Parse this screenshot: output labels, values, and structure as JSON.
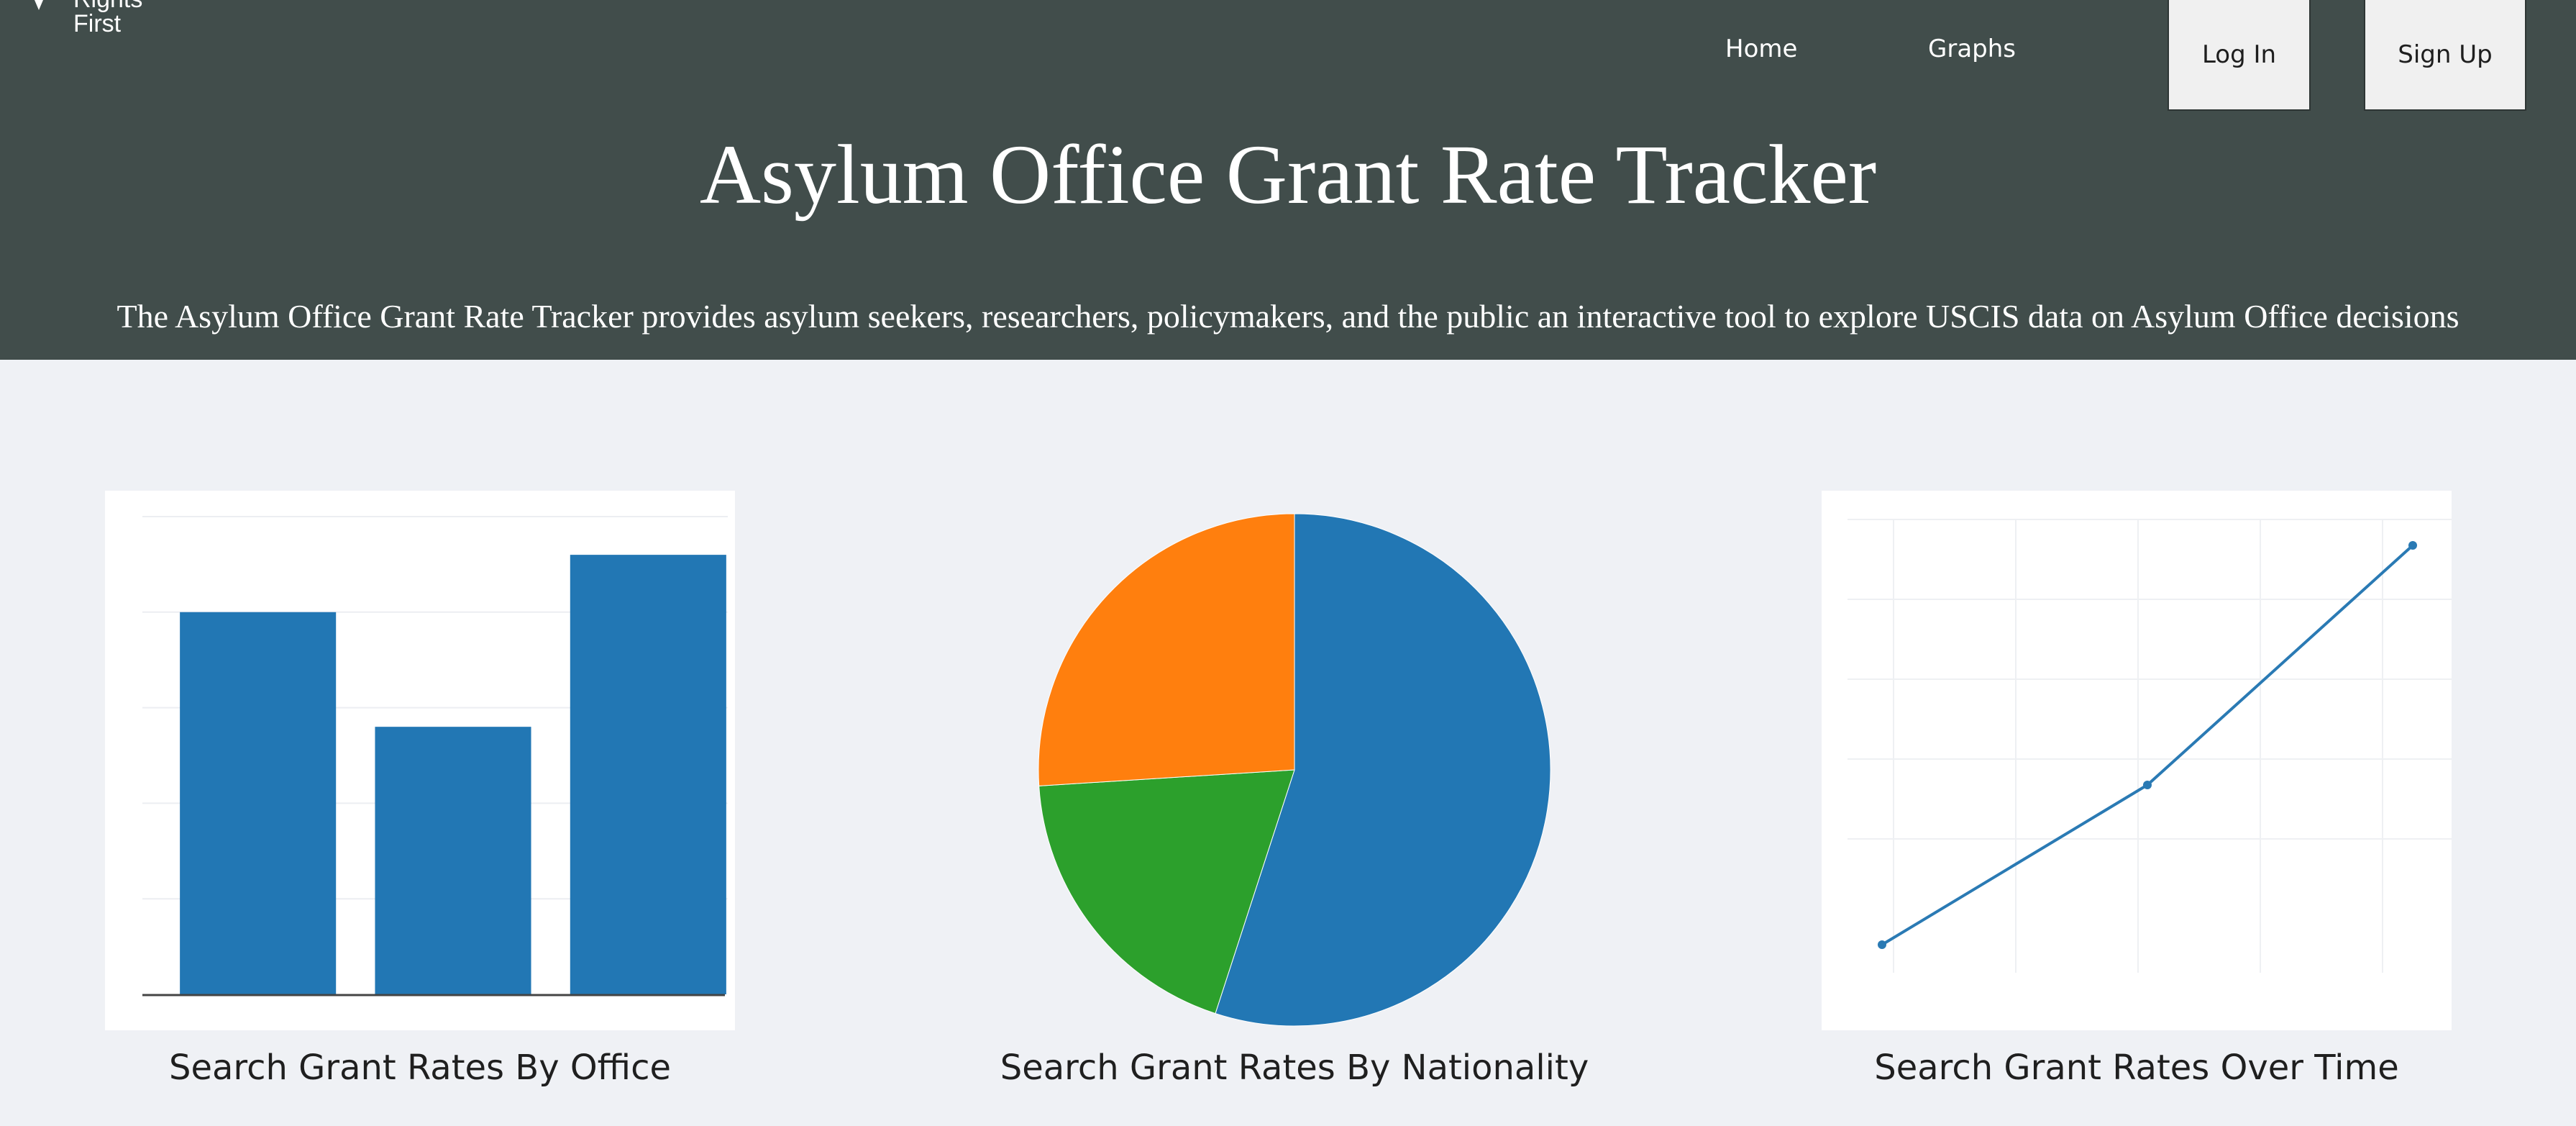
{
  "header": {
    "logo_text": [
      "Rights",
      "First"
    ],
    "nav": {
      "home": "Home",
      "graphs": "Graphs",
      "login": "Log In",
      "signup": "Sign Up"
    },
    "title": "Asylum Office Grant Rate Tracker",
    "subtitle": "The Asylum Office Grant Rate Tracker provides asylum seekers, researchers, policymakers, and the public an interactive tool to explore USCIS data on Asylum Office decisions"
  },
  "cards": [
    {
      "label": "Search Grant Rates By Office"
    },
    {
      "label": "Search Grant Rates By Nationality"
    },
    {
      "label": "Search Grant Rates Over Time"
    }
  ],
  "colors": {
    "header_bg": "#414d4b",
    "page_bg": "#eff1f5",
    "blue": "#2277b4",
    "orange": "#ff7f0e",
    "green": "#2ca02c"
  },
  "chart_data": [
    {
      "type": "bar",
      "categories": [
        "",
        "",
        ""
      ],
      "values": [
        80,
        56,
        92
      ],
      "ylim": [
        0,
        100
      ],
      "grid": true
    },
    {
      "type": "pie",
      "values": [
        55,
        19,
        26
      ],
      "colors": [
        "#2277b4",
        "#2ca02c",
        "#ff7f0e"
      ]
    },
    {
      "type": "line",
      "x": [
        0,
        1,
        2
      ],
      "y": [
        0,
        2,
        5
      ],
      "grid": true
    }
  ]
}
